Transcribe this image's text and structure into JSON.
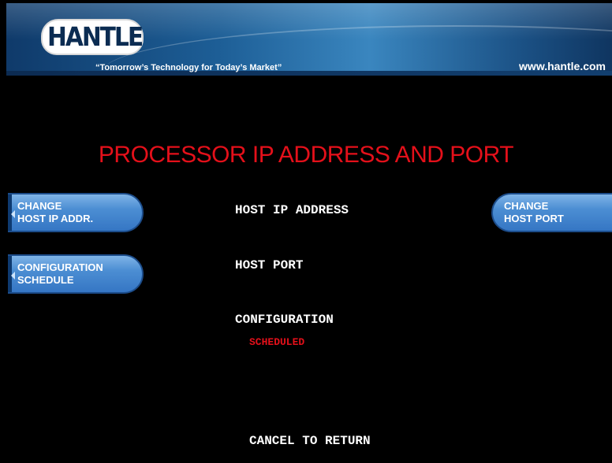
{
  "header": {
    "logo_text": "HANTLE",
    "tagline": "“Tomorrow’s Technology for Today’s Market”",
    "website": "www.hantle.com"
  },
  "screen": {
    "title": "PROCESSOR IP ADDRESS AND PORT",
    "host_ip_label": "HOST IP ADDRESS",
    "host_port_label": "HOST PORT",
    "configuration_label": "CONFIGURATION",
    "configuration_status": "SCHEDULED",
    "cancel_text": "CANCEL TO RETURN"
  },
  "buttons": {
    "change_host_ip": {
      "line1": "CHANGE",
      "line2": "HOST IP ADDR."
    },
    "configuration_schedule": {
      "line1": "CONFIGURATION",
      "line2": "SCHEDULE"
    },
    "change_host_port": {
      "line1": "CHANGE",
      "line2": "HOST PORT"
    }
  },
  "colors": {
    "background": "#000000",
    "title_red": "#e4101a",
    "button_blue": "#4c8ed3",
    "banner_blue": "#1d5e96"
  }
}
